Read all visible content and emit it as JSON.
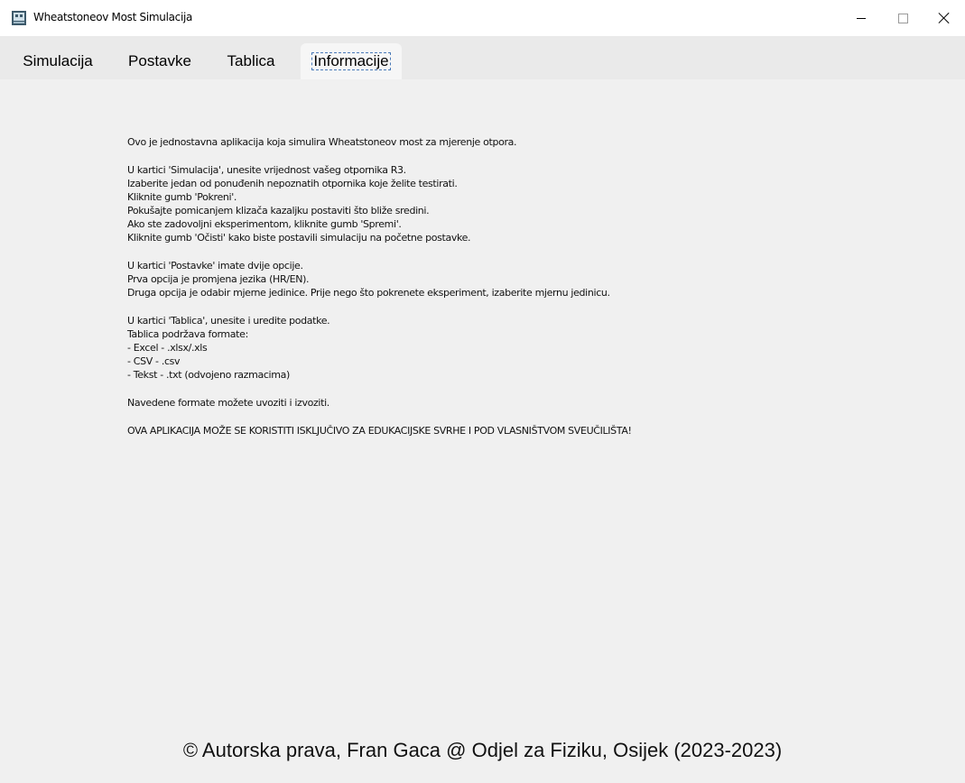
{
  "window": {
    "title": "Wheatstoneov Most Simulacija",
    "icon": "app-icon"
  },
  "tabs": [
    {
      "label": "Simulacija",
      "selected": false
    },
    {
      "label": "Postavke",
      "selected": false
    },
    {
      "label": "Tablica",
      "selected": false
    },
    {
      "label": "Informacije",
      "selected": true
    }
  ],
  "info": {
    "intro": "Ovo je jednostavna aplikacija koja simulira Wheatstoneov most za mjerenje otpora.",
    "simulacija": [
      "U kartici 'Simulacija', unesite vrijednost vašeg otpornika R3.",
      "Izaberite jedan od ponuđenih nepoznatih otpornika koje želite testirati.",
      "Kliknite gumb 'Pokreni'.",
      "Pokušajte pomicanjem klizača kazaljku postaviti što bliže sredini.",
      "Ako ste zadovoljni eksperimentom, kliknite gumb 'Spremi'.",
      "Kliknite gumb 'Očisti' kako biste postavili simulaciju na početne postavke."
    ],
    "postavke": [
      "U kartici 'Postavke' imate dvije opcije.",
      "Prva opcija je promjena jezika (HR/EN).",
      "Druga opcija je odabir mjerne jedinice. Prije nego što pokrenete eksperiment, izaberite mjernu jedinicu."
    ],
    "tablica": [
      "U kartici 'Tablica', unesite i uredite podatke.",
      "Tablica podržava formate:",
      "- Excel - .xlsx/.xls",
      "- CSV - .csv",
      "- Tekst - .txt (odvojeno razmacima)"
    ],
    "formats": "Navedene formate možete uvoziti i izvoziti.",
    "warning": "OVA APLIKACIJA MOŽE SE KORISTITI ISKLJUČIVO ZA EDUKACIJSKE SVRHE I POD VLASNIŠTVOM SVEUČILIŠTA!"
  },
  "footer": {
    "copyright": "© Autorska prava, Fran Gaca @ Odjel za Fiziku, Osijek (2023-2023)"
  }
}
